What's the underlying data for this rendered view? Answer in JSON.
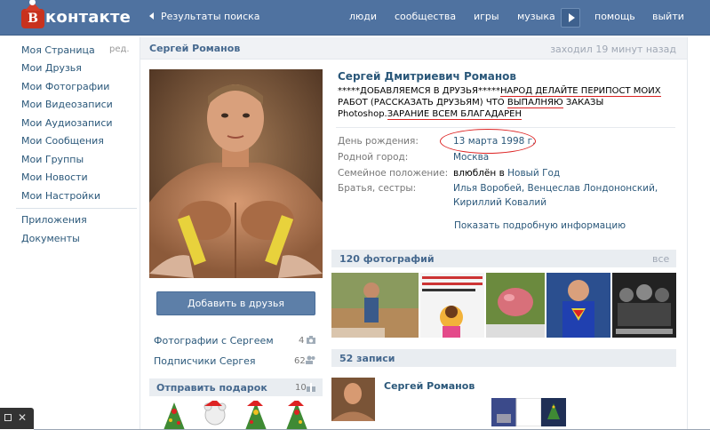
{
  "topbar": {
    "logo_text": "контакте",
    "logo_letter": "В",
    "back_label": "Результаты поиска",
    "nav": [
      "люди",
      "сообщества",
      "игры",
      "музыка",
      "помощь",
      "выйти"
    ]
  },
  "sidebar": {
    "edit_label": "ред.",
    "items": [
      "Моя Страница",
      "Мои Друзья",
      "Мои Фотографии",
      "Мои Видеозаписи",
      "Мои Аудиозаписи",
      "Мои Сообщения",
      "Мои Группы",
      "Мои Новости",
      "Мои Настройки"
    ],
    "extra": [
      "Приложения",
      "Документы"
    ]
  },
  "profile": {
    "header_name": "Сергей Романов",
    "last_seen": "заходил 19 минут назад",
    "full_name": "Сергей Дмитриевич Романов",
    "status_parts": {
      "p1": "*****ДОБАВЛЯЕМСЯ В ДРУЗЬЯ*****",
      "p2": "НАРОД ДЕЛАЙТЕ ПЕРИПОСТ МОИХ",
      "p3": " РАБОТ (РАССКАЗАТЬ ДРУЗЬЯМ) ЧТО ",
      "p4": "ВЫПАЛНЯЮ",
      "p5": " ЗАКАЗЫ Photoshop.",
      "p6": "ЗАРАНИЕ ВСЕМ БЛАГАДАРЕН"
    },
    "info": {
      "birthday_label": "День рождения:",
      "birthday_value": "13 марта 1998 г.",
      "hometown_label": "Родной город:",
      "hometown_value": "Москва",
      "family_label": "Семейное положение:",
      "family_prefix": "влюблён в ",
      "family_value": "Новый Год",
      "siblings_label": "Братья, сестры:",
      "siblings_line1": "Илья Воробей, Венцеслав Лондононский,",
      "siblings_line2": "Кириллий Ковалий",
      "more_info": "Показать подробную информацию"
    },
    "add_friend_button": "Добавить в друзья",
    "photos_with": "Фотографии с Сергеем",
    "photos_with_count": "4",
    "followers": "Подписчики Сергея",
    "followers_count": "62",
    "gift_title": "Отправить подарок",
    "gift_count": "10"
  },
  "photos": {
    "title": "120 фотографий",
    "all_label": "все"
  },
  "wall": {
    "title": "52 записи",
    "post_author": "Сергей Романов"
  },
  "colors": {
    "topbar": "#4f72a0",
    "link": "#2b587a",
    "section_head": "#e9edf1",
    "accent_red": "#d22222"
  }
}
